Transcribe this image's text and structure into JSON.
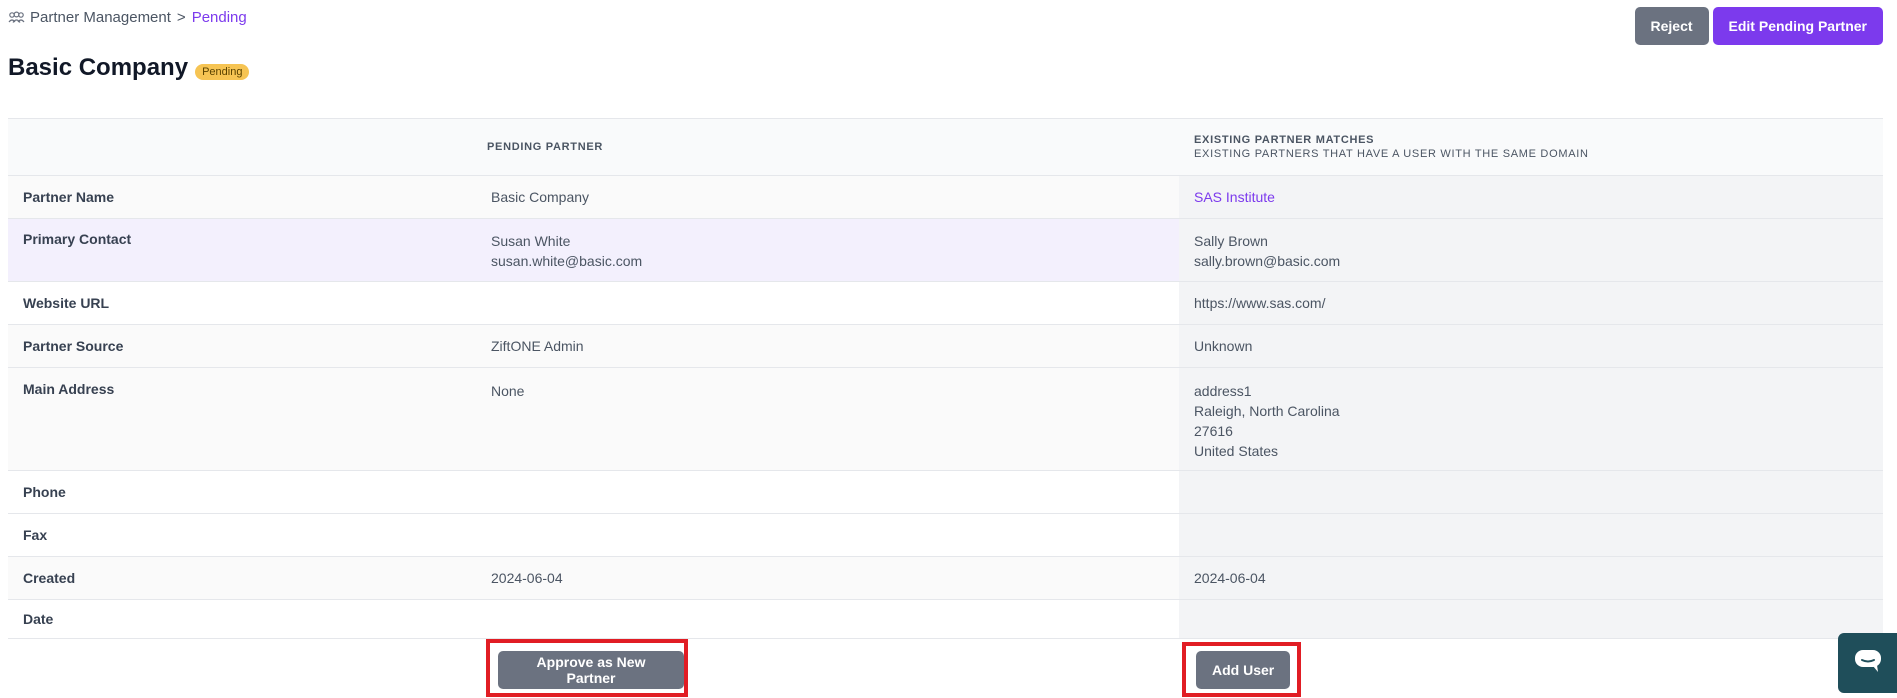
{
  "breadcrumb": {
    "icon": "users-icon",
    "parent": "Partner Management",
    "separator": ">",
    "current": "Pending"
  },
  "actions": {
    "reject": "Reject",
    "edit": "Edit Pending Partner"
  },
  "page": {
    "title": "Basic Company",
    "status_badge": "Pending"
  },
  "table": {
    "headers": {
      "pending": "PENDING PARTNER",
      "existing": "EXISTING PARTNER MATCHES",
      "existing_sub": "EXISTING PARTNERS THAT HAVE A USER WITH THE SAME DOMAIN"
    },
    "rows": {
      "partner_name": {
        "label": "Partner Name",
        "pending": "Basic Company",
        "existing": "SAS Institute"
      },
      "primary_contact": {
        "label": "Primary Contact",
        "pending_name": "Susan White",
        "pending_email": "susan.white@basic.com",
        "existing_name": "Sally Brown",
        "existing_email": "sally.brown@basic.com"
      },
      "website": {
        "label": "Website URL",
        "pending": "",
        "existing": "https://www.sas.com/"
      },
      "source": {
        "label": "Partner Source",
        "pending": "ZiftONE Admin",
        "existing": "Unknown"
      },
      "address": {
        "label": "Main Address",
        "pending": "None",
        "existing_line1": "address1",
        "existing_line2": "Raleigh, North Carolina",
        "existing_line3": "27616",
        "existing_line4": "United States"
      },
      "phone": {
        "label": "Phone",
        "pending": "",
        "existing": ""
      },
      "fax": {
        "label": "Fax",
        "pending": "",
        "existing": ""
      },
      "created": {
        "label": "Created",
        "pending": "2024-06-04",
        "existing": "2024-06-04"
      },
      "date": {
        "label": "Date",
        "pending": "",
        "existing": ""
      }
    }
  },
  "footer": {
    "approve": "Approve as New Partner",
    "add_user": "Add User"
  },
  "chat": {
    "icon": "chat-icon"
  },
  "colors": {
    "accent": "#7c3aed",
    "button_gray": "#6b7280",
    "badge": "#f6c453",
    "highlight_outline": "#e11d24",
    "chat_bg": "#1f4e5a"
  }
}
